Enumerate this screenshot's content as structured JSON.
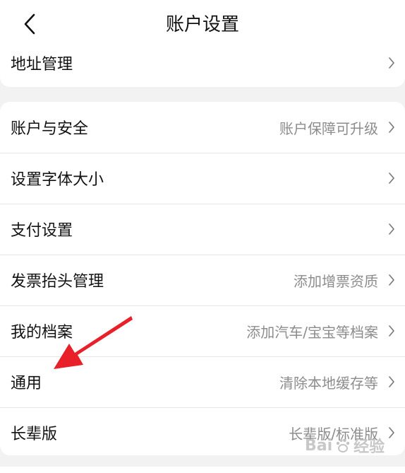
{
  "header": {
    "title": "账户设置",
    "back_icon": "chevron-left-icon"
  },
  "top_card": {
    "items": [
      {
        "label": "地址管理",
        "value": ""
      }
    ]
  },
  "settings": {
    "items": [
      {
        "label": "账户与安全",
        "value": "账户保障可升级"
      },
      {
        "label": "设置字体大小",
        "value": ""
      },
      {
        "label": "支付设置",
        "value": ""
      },
      {
        "label": "发票抬头管理",
        "value": "添加增票资质"
      },
      {
        "label": "我的档案",
        "value": "添加汽车/宝宝等档案"
      },
      {
        "label": "通用",
        "value": "清除本地缓存等"
      },
      {
        "label": "长辈版",
        "value": "长辈版/标准版"
      }
    ]
  },
  "annotation": {
    "arrow_color": "#e8202a"
  },
  "watermark": {
    "text_left": "Bai",
    "text_right": "经验"
  }
}
